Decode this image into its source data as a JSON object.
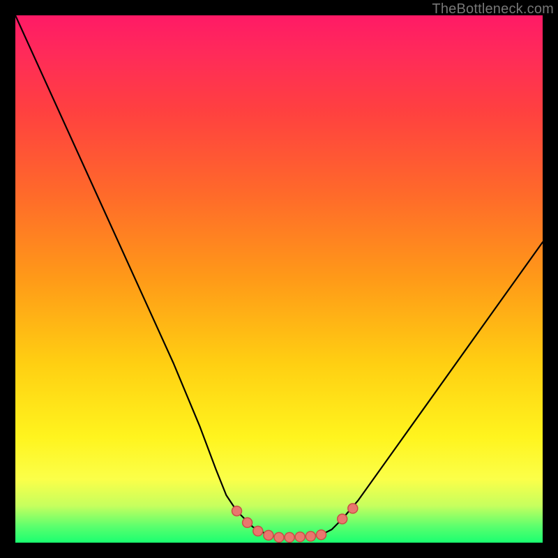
{
  "watermark": {
    "text": "TheBottleneck.com"
  },
  "chart_data": {
    "type": "line",
    "title": "",
    "xlabel": "",
    "ylabel": "",
    "xlim": [
      0,
      100
    ],
    "ylim": [
      0,
      100
    ],
    "series": [
      {
        "name": "bottleneck-curve",
        "x": [
          0,
          5,
          10,
          15,
          20,
          25,
          30,
          35,
          38,
          40,
          42,
          45,
          48,
          50,
          52,
          55,
          58,
          60,
          62,
          65,
          70,
          75,
          80,
          85,
          90,
          95,
          100
        ],
        "y": [
          100,
          89,
          78,
          67,
          56,
          45,
          34,
          22,
          14,
          9,
          6,
          3,
          1.4,
          1,
          1,
          1.2,
          1.5,
          2.5,
          4.5,
          8,
          15,
          22,
          29,
          36,
          43,
          50,
          57
        ]
      }
    ],
    "markers": [
      {
        "x": 42,
        "y": 6.0
      },
      {
        "x": 44,
        "y": 3.8
      },
      {
        "x": 46,
        "y": 2.2
      },
      {
        "x": 48,
        "y": 1.4
      },
      {
        "x": 50,
        "y": 1.0
      },
      {
        "x": 52,
        "y": 1.0
      },
      {
        "x": 54,
        "y": 1.1
      },
      {
        "x": 56,
        "y": 1.2
      },
      {
        "x": 58,
        "y": 1.5
      },
      {
        "x": 62,
        "y": 4.5
      },
      {
        "x": 64,
        "y": 6.5
      }
    ],
    "gradient_stops": [
      {
        "pct": 0,
        "color": "#ff1a66"
      },
      {
        "pct": 18,
        "color": "#ff4040"
      },
      {
        "pct": 50,
        "color": "#ff9a18"
      },
      {
        "pct": 80,
        "color": "#fff41e"
      },
      {
        "pct": 97,
        "color": "#59ff6e"
      },
      {
        "pct": 100,
        "color": "#1aff70"
      }
    ],
    "marker_style": {
      "fill": "#e9776e",
      "stroke": "#c94f46",
      "r": 7
    }
  }
}
